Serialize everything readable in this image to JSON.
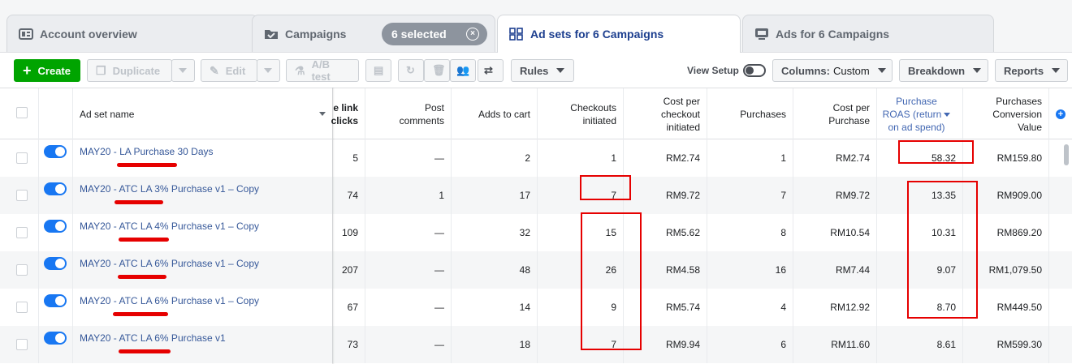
{
  "tabs": [
    {
      "label": "Account overview",
      "icon": "dashboard-icon"
    },
    {
      "label": "Campaigns",
      "icon": "folder-check-icon"
    },
    {
      "label": "Ad sets for 6 Campaigns",
      "icon": "grid-icon"
    },
    {
      "label": "Ads for 6 Campaigns",
      "icon": "monitor-icon"
    }
  ],
  "selection": {
    "label": "6 selected",
    "clear": "×"
  },
  "toolbar": {
    "create": "Create",
    "duplicate": "Duplicate",
    "edit": "Edit",
    "ab_test": "A/B test",
    "rules": "Rules",
    "view_setup": "View Setup",
    "columns_prefix": "Columns:",
    "columns_value": "Custom",
    "breakdown": "Breakdown",
    "reports": "Reports"
  },
  "table": {
    "headers": {
      "name": "Ad set name",
      "link_clicks": [
        "e link",
        "clicks"
      ],
      "post_comments": [
        "Post",
        "comments"
      ],
      "adds_to_cart": "Adds to cart",
      "checkouts": [
        "Checkouts",
        "initiated"
      ],
      "cost_per_checkout": [
        "Cost per",
        "checkout",
        "initiated"
      ],
      "purchases": "Purchases",
      "cost_per_purchase": [
        "Cost per",
        "Purchase"
      ],
      "roas": [
        "Purchase",
        "ROAS (return",
        "on ad spend)"
      ],
      "conversion_value": [
        "Purchases",
        "Conversion",
        "Value"
      ]
    },
    "rows": [
      {
        "name": "MAY20 - LA Purchase 30 Days",
        "link_clicks": "5",
        "post_comments": "—",
        "adds_to_cart": "2",
        "checkouts": "1",
        "cost_per_checkout": "RM2.74",
        "purchases": "1",
        "cost_per_purchase": "RM2.74",
        "roas": "58.32",
        "conversion_value": "RM159.80"
      },
      {
        "name": "MAY20 - ATC LA 3% Purchase v1 – Copy",
        "link_clicks": "74",
        "post_comments": "1",
        "adds_to_cart": "17",
        "checkouts": "7",
        "cost_per_checkout": "RM9.72",
        "purchases": "7",
        "cost_per_purchase": "RM9.72",
        "roas": "13.35",
        "conversion_value": "RM909.00"
      },
      {
        "name": "MAY20 - ATC LA 4% Purchase v1 – Copy",
        "link_clicks": "109",
        "post_comments": "—",
        "adds_to_cart": "32",
        "checkouts": "15",
        "cost_per_checkout": "RM5.62",
        "purchases": "8",
        "cost_per_purchase": "RM10.54",
        "roas": "10.31",
        "conversion_value": "RM869.20"
      },
      {
        "name": "MAY20 - ATC LA 6% Purchase v1 – Copy",
        "link_clicks": "207",
        "post_comments": "—",
        "adds_to_cart": "48",
        "checkouts": "26",
        "cost_per_checkout": "RM4.58",
        "purchases": "16",
        "cost_per_purchase": "RM7.44",
        "roas": "9.07",
        "conversion_value": "RM1,079.50"
      },
      {
        "name": "MAY20 - ATC LA 6% Purchase v1 – Copy",
        "link_clicks": "67",
        "post_comments": "—",
        "adds_to_cart": "14",
        "checkouts": "9",
        "cost_per_checkout": "RM5.74",
        "purchases": "4",
        "cost_per_purchase": "RM12.92",
        "roas": "8.70",
        "conversion_value": "RM449.50"
      },
      {
        "name": "MAY20 - ATC LA 6% Purchase v1",
        "link_clicks": "73",
        "post_comments": "—",
        "adds_to_cart": "18",
        "checkouts": "7",
        "cost_per_checkout": "RM9.94",
        "purchases": "6",
        "cost_per_purchase": "RM11.60",
        "roas": "8.61",
        "conversion_value": "RM599.30"
      }
    ]
  },
  "colors": {
    "accent": "#1877f2",
    "create": "#00a400",
    "annotation": "#e60000",
    "link": "#365899"
  }
}
